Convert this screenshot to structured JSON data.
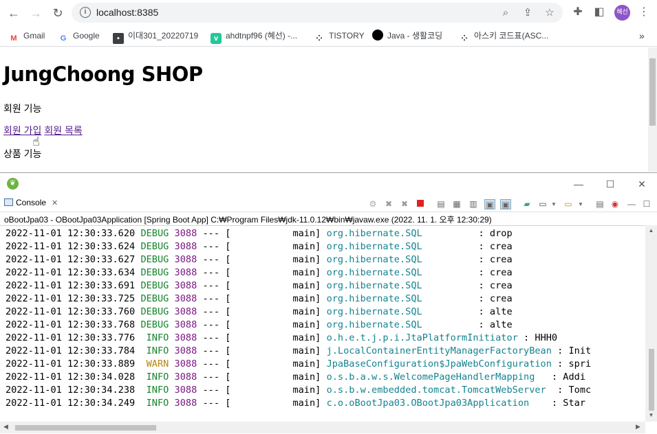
{
  "browser": {
    "url": "localhost:8385",
    "profile_initials": "혜선",
    "bookmarks": [
      {
        "label": "Gmail",
        "icon": "gmail-icon"
      },
      {
        "label": "Google",
        "icon": "google-icon"
      },
      {
        "label": "이대301_20220719",
        "icon": "contact-card-icon"
      },
      {
        "label": "ahdtnpf96 (혜선) -...",
        "icon": "velog-icon"
      },
      {
        "label": "TISTORY",
        "icon": "tistory-icon"
      },
      {
        "label": "Java - 생활코딩",
        "icon": "circle-icon"
      },
      {
        "label": "아스키 코드표(ASC...",
        "icon": "tistory-icon"
      }
    ],
    "more_bookmarks": "»"
  },
  "page": {
    "title": "JungChoong SHOP",
    "member_section": "회원 기능",
    "links": [
      "회원 가입",
      "회원 목록"
    ],
    "product_section": "상품 기능"
  },
  "eclipse": {
    "console_tab": "Console",
    "console_tab_close": "✕",
    "description": "oBootJpa03 - OBootJpa03Application [Spring Boot App] C:₩Program Files₩jdk-11.0.12₩bin₩javaw.exe  (2022. 11. 1. 오후 12:30:29)",
    "log_lines": [
      {
        "ts": "2022-11-01 12:30:33.620",
        "level": "DEBUG",
        "pid": "3088",
        "sep": "---",
        "thread": "[           main]",
        "logger": "org.hibernate.SQL",
        "msg": "          : drop"
      },
      {
        "ts": "2022-11-01 12:30:33.624",
        "level": "DEBUG",
        "pid": "3088",
        "sep": "---",
        "thread": "[           main]",
        "logger": "org.hibernate.SQL",
        "msg": "          : crea"
      },
      {
        "ts": "2022-11-01 12:30:33.627",
        "level": "DEBUG",
        "pid": "3088",
        "sep": "---",
        "thread": "[           main]",
        "logger": "org.hibernate.SQL",
        "msg": "          : crea"
      },
      {
        "ts": "2022-11-01 12:30:33.634",
        "level": "DEBUG",
        "pid": "3088",
        "sep": "---",
        "thread": "[           main]",
        "logger": "org.hibernate.SQL",
        "msg": "          : crea"
      },
      {
        "ts": "2022-11-01 12:30:33.691",
        "level": "DEBUG",
        "pid": "3088",
        "sep": "---",
        "thread": "[           main]",
        "logger": "org.hibernate.SQL",
        "msg": "          : crea"
      },
      {
        "ts": "2022-11-01 12:30:33.725",
        "level": "DEBUG",
        "pid": "3088",
        "sep": "---",
        "thread": "[           main]",
        "logger": "org.hibernate.SQL",
        "msg": "          : crea"
      },
      {
        "ts": "2022-11-01 12:30:33.760",
        "level": "DEBUG",
        "pid": "3088",
        "sep": "---",
        "thread": "[           main]",
        "logger": "org.hibernate.SQL",
        "msg": "          : alte"
      },
      {
        "ts": "2022-11-01 12:30:33.768",
        "level": "DEBUG",
        "pid": "3088",
        "sep": "---",
        "thread": "[           main]",
        "logger": "org.hibernate.SQL",
        "msg": "          : alte"
      },
      {
        "ts": "2022-11-01 12:30:33.776",
        "level": " INFO",
        "pid": "3088",
        "sep": "---",
        "thread": "[           main]",
        "logger": "o.h.e.t.j.p.i.JtaPlatformInitiator",
        "msg": " : HHH0"
      },
      {
        "ts": "2022-11-01 12:30:33.784",
        "level": " INFO",
        "pid": "3088",
        "sep": "---",
        "thread": "[           main]",
        "logger": "j.LocalContainerEntityManagerFactoryBean",
        "msg": " : Init"
      },
      {
        "ts": "2022-11-01 12:30:33.889",
        "level": " WARN",
        "pid": "3088",
        "sep": "---",
        "thread": "[           main]",
        "logger": "JpaBaseConfiguration$JpaWebConfiguration",
        "msg": " : spri"
      },
      {
        "ts": "2022-11-01 12:30:34.028",
        "level": " INFO",
        "pid": "3088",
        "sep": "---",
        "thread": "[           main]",
        "logger": "o.s.b.a.w.s.WelcomePageHandlerMapping",
        "msg": "   : Addi"
      },
      {
        "ts": "2022-11-01 12:30:34.238",
        "level": " INFO",
        "pid": "3088",
        "sep": "---",
        "thread": "[           main]",
        "logger": "o.s.b.w.embedded.tomcat.TomcatWebServer",
        "msg": "  : Tomc"
      },
      {
        "ts": "2022-11-01 12:30:34.249",
        "level": " INFO",
        "pid": "3088",
        "sep": "---",
        "thread": "[           main]",
        "logger": "c.o.oBootJpa03.OBootJpa03Application",
        "msg": "    : Star"
      }
    ]
  },
  "colors": {
    "link": "#551a8b",
    "debug": "#15852b",
    "warn": "#b5880e",
    "pid": "#7a1780",
    "logger": "#13838f",
    "avatar": "#8e55c8"
  }
}
